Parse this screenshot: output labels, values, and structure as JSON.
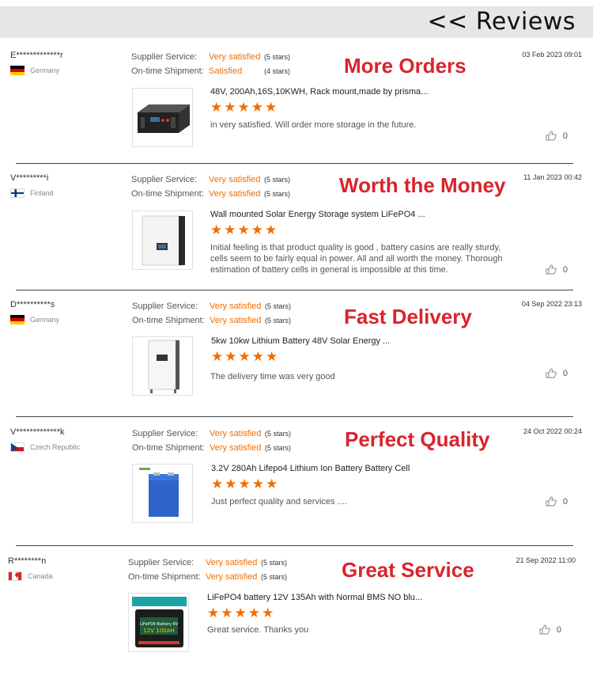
{
  "header": {
    "title": "<< Reviews"
  },
  "labels": {
    "supplier_service": "Supplier Service:",
    "shipment": "On-time Shipment:"
  },
  "reviews": [
    {
      "reviewer": "E*************r",
      "country": "Germany",
      "flag": "de",
      "date": "03 Feb 2023 09:01",
      "supplier_rating": "Very satisfied",
      "supplier_stars": "(5 stars)",
      "shipment_rating": "Satisfied",
      "shipment_stars": "(4 stars)",
      "banner": "More Orders",
      "product": "48V, 200Ah,16S,10KWH, Rack mount,made by prisma...",
      "stars": 5,
      "comment": "in very satisfied. Will order more storage in the future.",
      "likes": "0"
    },
    {
      "reviewer": "V*********i",
      "country": "Finland",
      "flag": "fi",
      "date": "11 Jan 2023 00:42",
      "supplier_rating": "Very satisfied",
      "supplier_stars": "(5 stars)",
      "shipment_rating": "Very satisfied",
      "shipment_stars": "(5 stars)",
      "banner": "Worth the Money",
      "product": "Wall mounted Solar Energy Storage system LiFePO4 ...",
      "stars": 5,
      "comment": "Initial feeling is that product quality is good , battery casins are really sturdy, cells seem to be fairly equal in power. All and all worth the money. Thorough estimation of battery cells in general is impossible at this time.",
      "likes": "0"
    },
    {
      "reviewer": "D**********s",
      "country": "Germany",
      "flag": "de",
      "date": "04 Sep 2022 23:13",
      "supplier_rating": "Very satisfied",
      "supplier_stars": "(5 stars)",
      "shipment_rating": "Very satisfied",
      "shipment_stars": "(5 stars)",
      "banner": "Fast Delivery",
      "product": "5kw 10kw Lithium Battery 48V Solar Energy ...",
      "stars": 5,
      "comment": "The delivery time was very good",
      "likes": "0"
    },
    {
      "reviewer": "V*************k",
      "country": "Czech Republic",
      "flag": "cz",
      "date": "24 Oct 2022 00:24",
      "supplier_rating": "Very satisfied",
      "supplier_stars": "(5 stars)",
      "shipment_rating": "Very satisfied",
      "shipment_stars": "(5 stars)",
      "banner": "Perfect Quality",
      "product": "3.2V 280Ah Lifepo4 Lithium Ion Battery Battery Cell",
      "stars": 5,
      "comment": "Just perfect quality and services ....",
      "likes": "0"
    },
    {
      "reviewer": "R********n",
      "country": "Canada",
      "flag": "ca",
      "date": "21 Sep 2022 11:00",
      "supplier_rating": "Very satisfied",
      "supplier_stars": "(5 stars)",
      "shipment_rating": "Very satisfied",
      "shipment_stars": "(5 stars)",
      "banner": "Great Service",
      "product": "LiFePO4 battery 12V 135Ah with Normal BMS NO blu...",
      "stars": 5,
      "comment": "Great service. Thanks you",
      "likes": "0"
    }
  ],
  "product_images": {
    "battery_label": "LiFePO4 Battery 6V",
    "battery_spec": "12V 100AH"
  },
  "colors": {
    "accent": "#f26d00",
    "banner": "#d8242c",
    "header_bg": "#e6e6e6"
  }
}
